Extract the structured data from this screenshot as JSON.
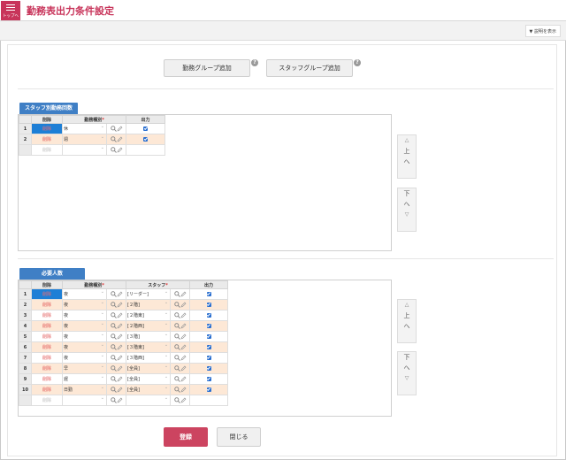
{
  "header": {
    "menu_label": "トップへ",
    "title": "勤務表出力条件設定",
    "explain_label": "説明を表示"
  },
  "actions": {
    "add_shift_group": "勤務グループ追加",
    "add_staff_group": "スタッフグループ追加",
    "help": "?"
  },
  "section1": {
    "tab": "スタッフ別勤務回数",
    "columns": [
      "削除",
      "勤務種別",
      "出力"
    ],
    "rows": [
      {
        "no": "1",
        "delete": "削除",
        "shift": "休",
        "output": true
      },
      {
        "no": "2",
        "delete": "削除",
        "shift": "週",
        "output": true
      },
      {
        "no": "",
        "delete": "削除",
        "shift": "",
        "output": false
      }
    ]
  },
  "section2": {
    "tab": "必要人数",
    "columns": [
      "削除",
      "勤務種別",
      "スタッフ",
      "出力"
    ],
    "rows": [
      {
        "no": "1",
        "delete": "削除",
        "shift": "夜",
        "staff": "[リーダー]",
        "output": true
      },
      {
        "no": "2",
        "delete": "削除",
        "shift": "夜",
        "staff": "[２階]",
        "output": true
      },
      {
        "no": "3",
        "delete": "削除",
        "shift": "夜",
        "staff": "[２階東]",
        "output": true
      },
      {
        "no": "4",
        "delete": "削除",
        "shift": "夜",
        "staff": "[２階西]",
        "output": true
      },
      {
        "no": "5",
        "delete": "削除",
        "shift": "夜",
        "staff": "[３階]",
        "output": true
      },
      {
        "no": "6",
        "delete": "削除",
        "shift": "夜",
        "staff": "[３階東]",
        "output": true
      },
      {
        "no": "7",
        "delete": "削除",
        "shift": "夜",
        "staff": "[３階西]",
        "output": true
      },
      {
        "no": "8",
        "delete": "削除",
        "shift": "早",
        "staff": "[全員]",
        "output": true
      },
      {
        "no": "9",
        "delete": "削除",
        "shift": "遅",
        "staff": "[全員]",
        "output": true
      },
      {
        "no": "10",
        "delete": "削除",
        "shift": "日勤",
        "staff": "[全員]",
        "output": true
      },
      {
        "no": "",
        "delete": "削除",
        "shift": "",
        "staff": "",
        "output": false
      }
    ]
  },
  "move": {
    "up_tri": "△",
    "up": "上",
    "up_caret": "へ",
    "down": "下",
    "down_caret": "へ",
    "down_tri": "▽"
  },
  "footer": {
    "register": "登録",
    "close": "閉じる"
  },
  "colors": {
    "accent": "#c8345a",
    "tab_blue": "#3f7fc5",
    "row_alt": "#fde8d6",
    "selected": "#1e7fd6"
  }
}
